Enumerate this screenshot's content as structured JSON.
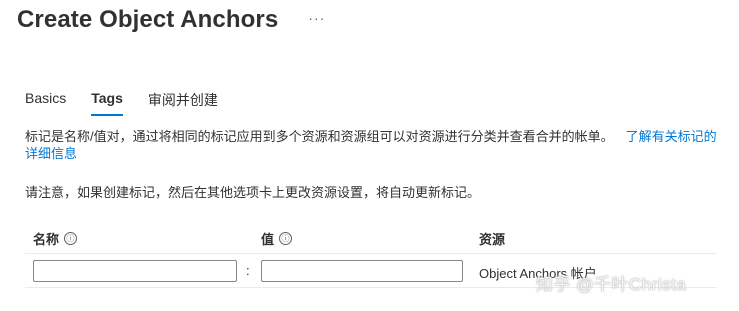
{
  "header": {
    "title": "Create Object Anchors",
    "more_label": "···"
  },
  "tabs": [
    {
      "label": "Basics",
      "active": false
    },
    {
      "label": "Tags",
      "active": true
    },
    {
      "label": "审阅并创建",
      "active": false
    }
  ],
  "description": {
    "text": "标记是名称/值对，通过将相同的标记应用到多个资源和资源组可以对资源进行分类并查看合并的帐单。",
    "link": "了解有关标记的详细信息"
  },
  "notice": "请注意，如果创建标记，然后在其他选项卡上更改资源设置，将自动更新标记。",
  "table": {
    "columns": {
      "name": "名称",
      "value": "值",
      "resource": "资源"
    },
    "info_icon": "ⓘ",
    "row": {
      "name_value": "",
      "separator": ":",
      "value_value": "",
      "resource": "Object Anchors 帐户"
    }
  },
  "watermark": "知乎 @千叶Christa",
  "colors": {
    "accent": "#0078d4",
    "text": "#323130",
    "border": "#8a8886"
  },
  "icons": {
    "info": "info-icon",
    "more": "more-icon"
  }
}
